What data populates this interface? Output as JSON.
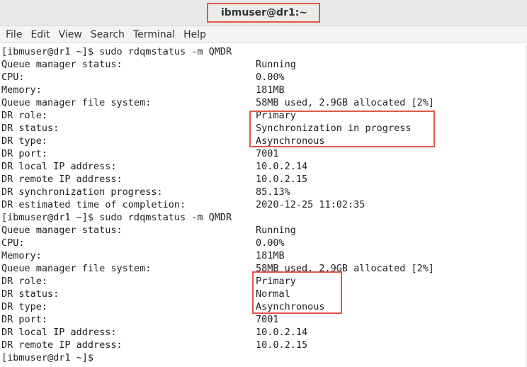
{
  "window": {
    "title": "ibmuser@dr1:~"
  },
  "menu": [
    "File",
    "Edit",
    "View",
    "Search",
    "Terminal",
    "Help"
  ],
  "terminal": {
    "lines": [
      {
        "k": "[ibmuser@dr1 ~]$ sudo rdqmstatus -m QMDR",
        "v": ""
      },
      {
        "k": "Queue manager status:",
        "v": "Running"
      },
      {
        "k": "CPU:",
        "v": "0.00%"
      },
      {
        "k": "Memory:",
        "v": "181MB"
      },
      {
        "k": "Queue manager file system:",
        "v": "58MB used, 2.9GB allocated [2%]"
      },
      {
        "k": "DR role:",
        "v": "Primary"
      },
      {
        "k": "DR status:",
        "v": "Synchronization in progress"
      },
      {
        "k": "DR type:",
        "v": "Asynchronous"
      },
      {
        "k": "DR port:",
        "v": "7001"
      },
      {
        "k": "DR local IP address:",
        "v": "10.0.2.14"
      },
      {
        "k": "DR remote IP address:",
        "v": "10.0.2.15"
      },
      {
        "k": "DR synchronization progress:",
        "v": "85.13%"
      },
      {
        "k": "DR estimated time of completion:",
        "v": "2020-12-25 11:02:35"
      },
      {
        "k": "[ibmuser@dr1 ~]$ sudo rdqmstatus -m QMDR",
        "v": ""
      },
      {
        "k": "Queue manager status:",
        "v": "Running"
      },
      {
        "k": "CPU:",
        "v": "0.00%"
      },
      {
        "k": "Memory:",
        "v": "181MB"
      },
      {
        "k": "Queue manager file system:",
        "v": "58MB used, 2.9GB allocated [2%]"
      },
      {
        "k": "DR role:",
        "v": "Primary"
      },
      {
        "k": "DR status:",
        "v": "Normal"
      },
      {
        "k": "DR type:",
        "v": "Asynchronous"
      },
      {
        "k": "DR port:",
        "v": "7001"
      },
      {
        "k": "DR local IP address:",
        "v": "10.0.2.14"
      },
      {
        "k": "DR remote IP address:",
        "v": "10.0.2.15"
      },
      {
        "k": "[ibmuser@dr1 ~]$",
        "v": ""
      }
    ]
  },
  "colors": {
    "highlight": "#e0584a",
    "text": "#1f1f1f",
    "titlebar": "#e9e9e7"
  }
}
